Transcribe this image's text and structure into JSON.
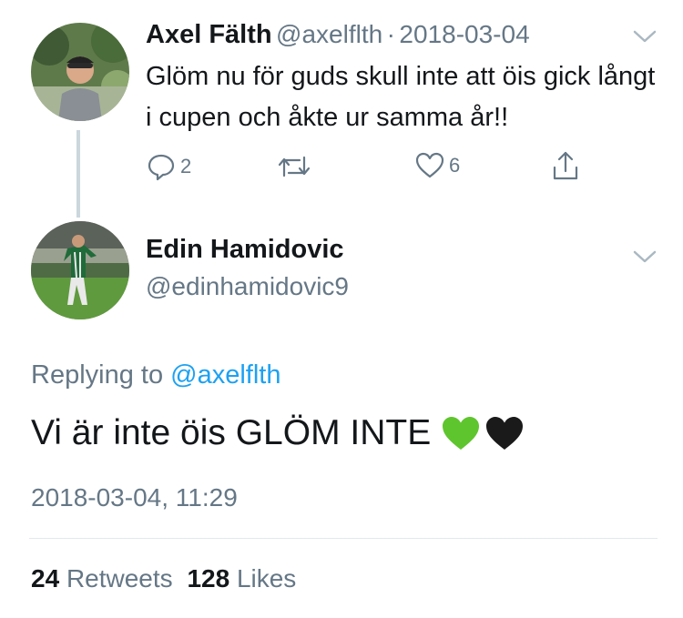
{
  "parent_tweet": {
    "author_name": "Axel Fälth",
    "handle": "@axelflth",
    "separator": "·",
    "date": "2018-03-04",
    "text": "Glöm nu för guds skull inte att öis gick långt i cupen och åkte ur samma år!!",
    "reply_count": "2",
    "retweet_count": "",
    "like_count": "6"
  },
  "main_tweet": {
    "author_name": "Edin Hamidovic",
    "handle": "@edinhamidovic9",
    "replying_prefix": "Replying to",
    "replying_to": "@axelflth",
    "text": "Vi är inte öis GLÖM INTE",
    "emoji": [
      "green-heart",
      "black-heart"
    ],
    "timestamp": "2018-03-04, 11:29",
    "retweets_count": "24",
    "retweets_label": "Retweets",
    "likes_count": "128",
    "likes_label": "Likes"
  },
  "colors": {
    "text_primary": "#14171a",
    "text_secondary": "#657786",
    "link": "#1da1f2",
    "thread_line": "#ccd6dd",
    "green_heart": "#5fc52e",
    "black_heart": "#1a1a1a"
  }
}
